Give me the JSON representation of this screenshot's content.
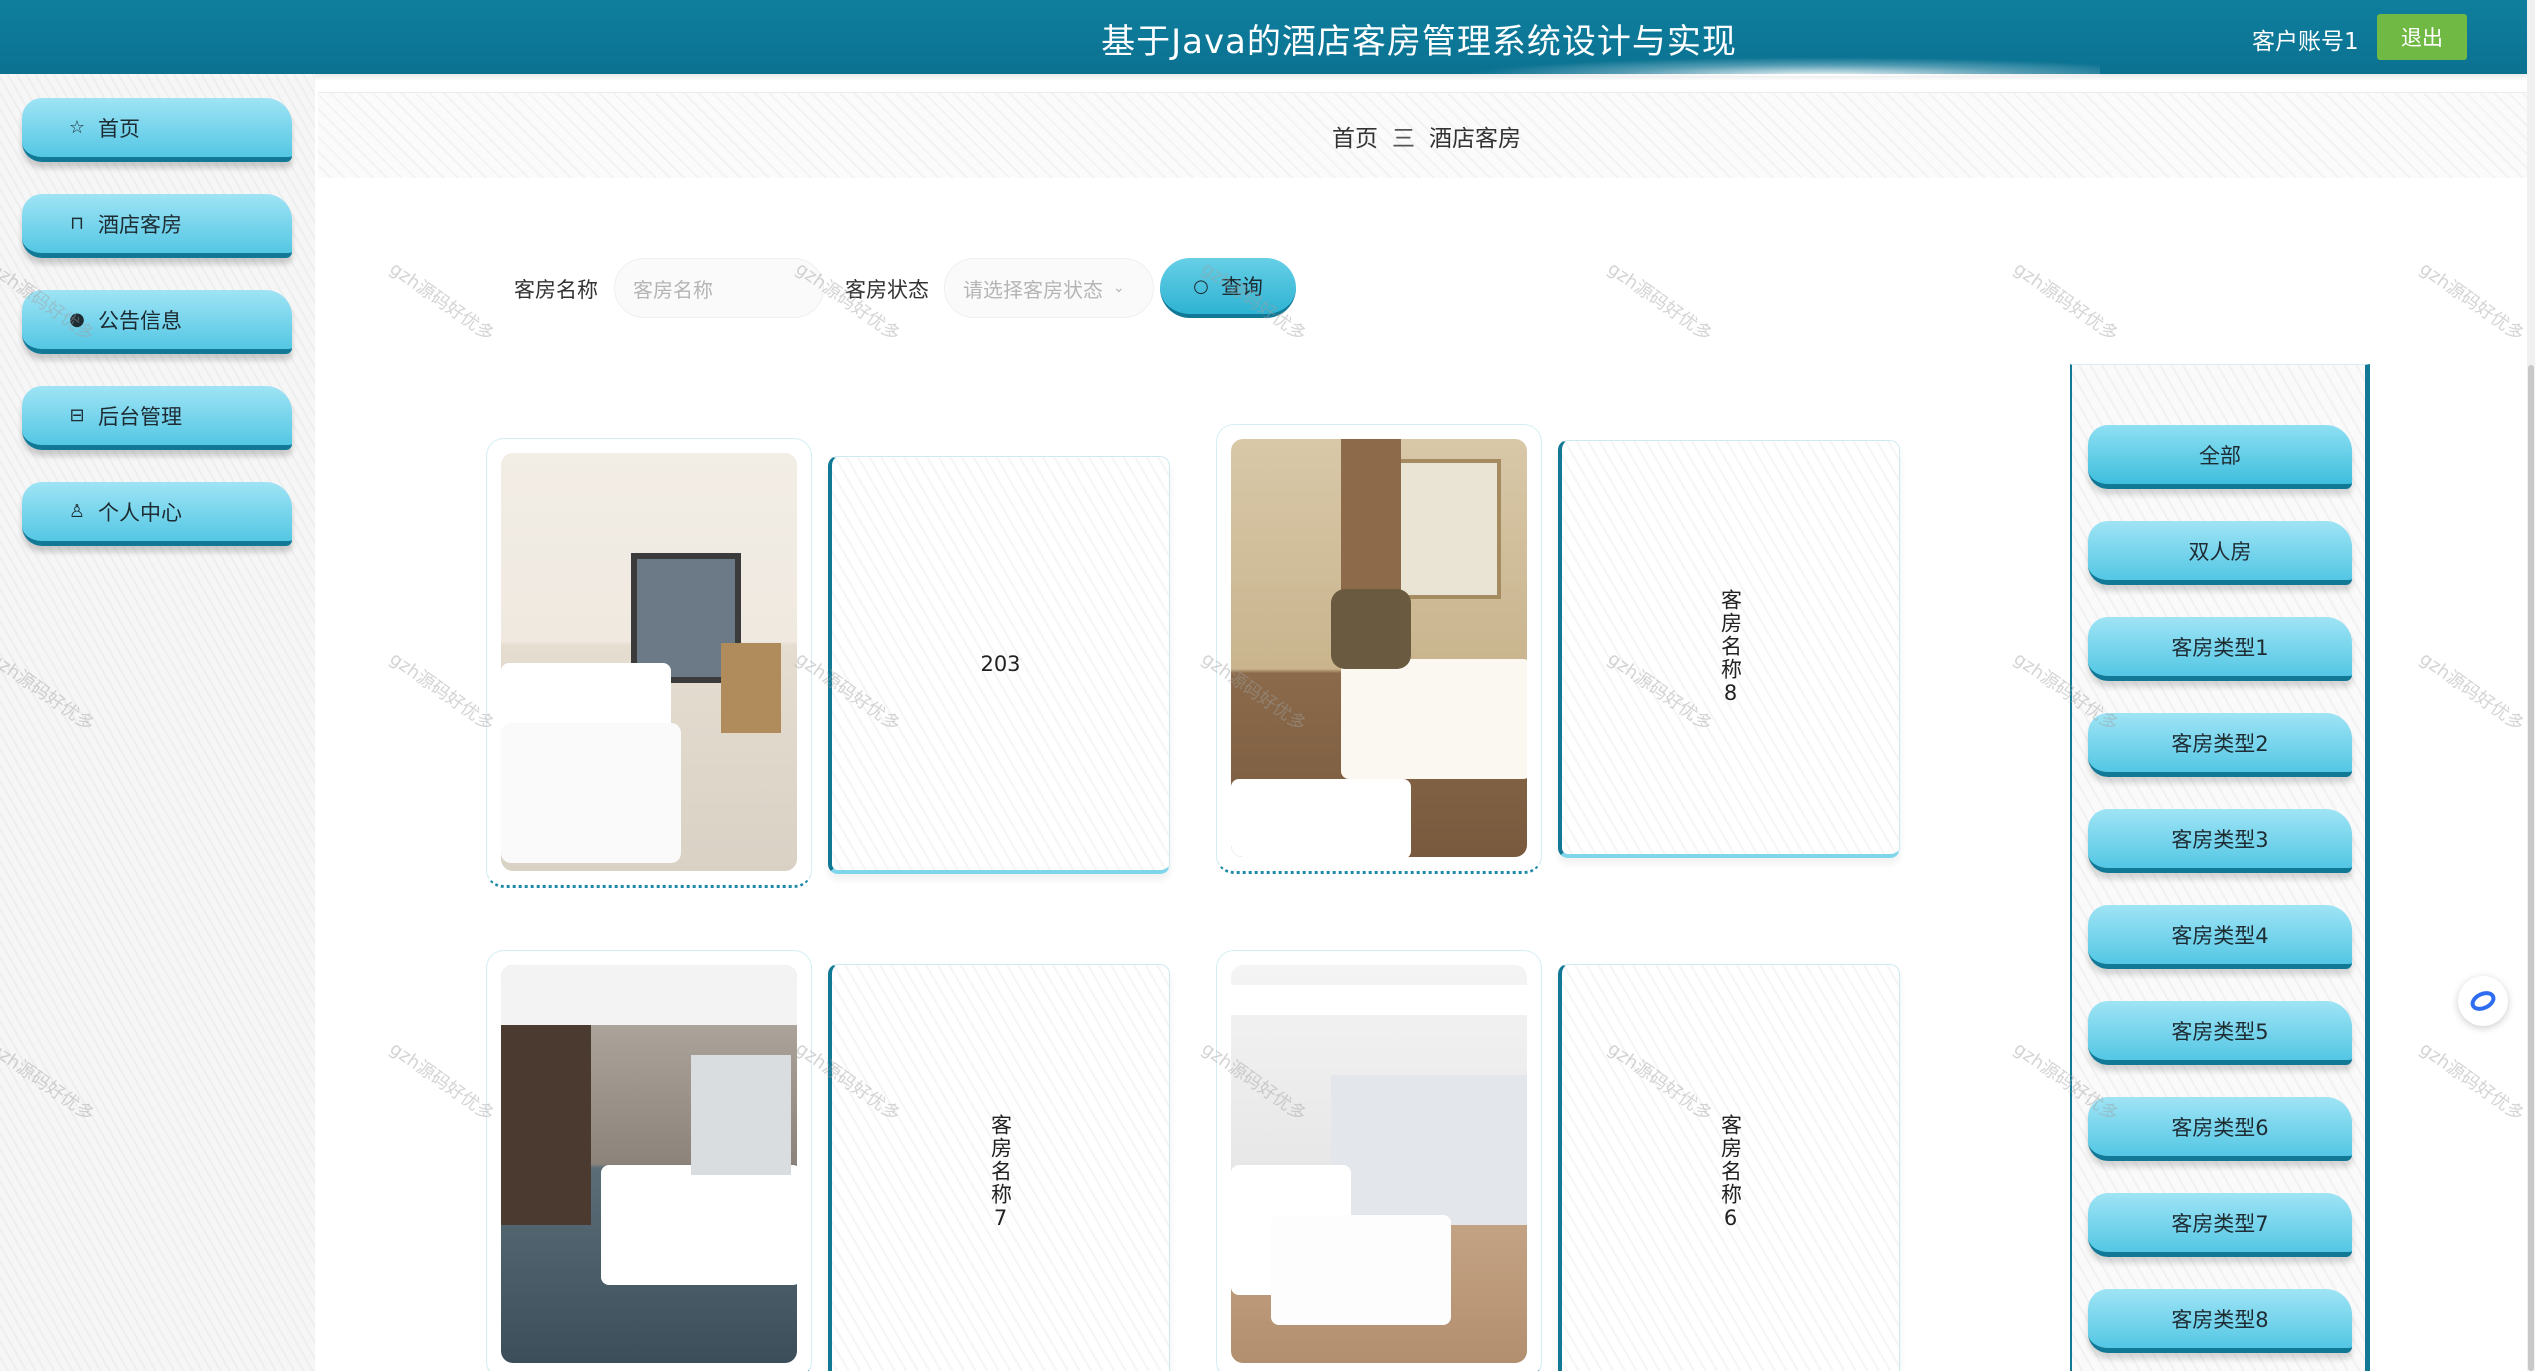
{
  "header": {
    "title": "基于Java的酒店客房管理系统设计与实现",
    "user": "客户账号1",
    "logout_label": "退出"
  },
  "sidebar": {
    "items": [
      {
        "label": "首页",
        "icon": "star-icon"
      },
      {
        "label": "酒店客房",
        "icon": "bag-icon"
      },
      {
        "label": "公告信息",
        "icon": "info-icon"
      },
      {
        "label": "后台管理",
        "icon": "box-icon"
      },
      {
        "label": "个人中心",
        "icon": "user-icon"
      }
    ]
  },
  "breadcrumb": {
    "home": "首页",
    "separator": "三",
    "current": "酒店客房"
  },
  "search": {
    "name_label": "客房名称",
    "name_placeholder": "客房名称",
    "status_label": "客房状态",
    "status_placeholder": "请选择客房状态",
    "button_label": "查询"
  },
  "rooms": [
    {
      "name": "203"
    },
    {
      "name": "客房名称8"
    },
    {
      "name": "客房名称7"
    },
    {
      "name": "客房名称6"
    }
  ],
  "filters": [
    "全部",
    "双人房",
    "客房类型1",
    "客房类型2",
    "客房类型3",
    "客房类型4",
    "客房类型5",
    "客房类型6",
    "客房类型7",
    "客房类型8"
  ],
  "watermark": "gzh源码好优多",
  "colors": {
    "primary": "#0f7f9e",
    "accent_light": "#54c7e4",
    "logout": "#6fb944"
  }
}
